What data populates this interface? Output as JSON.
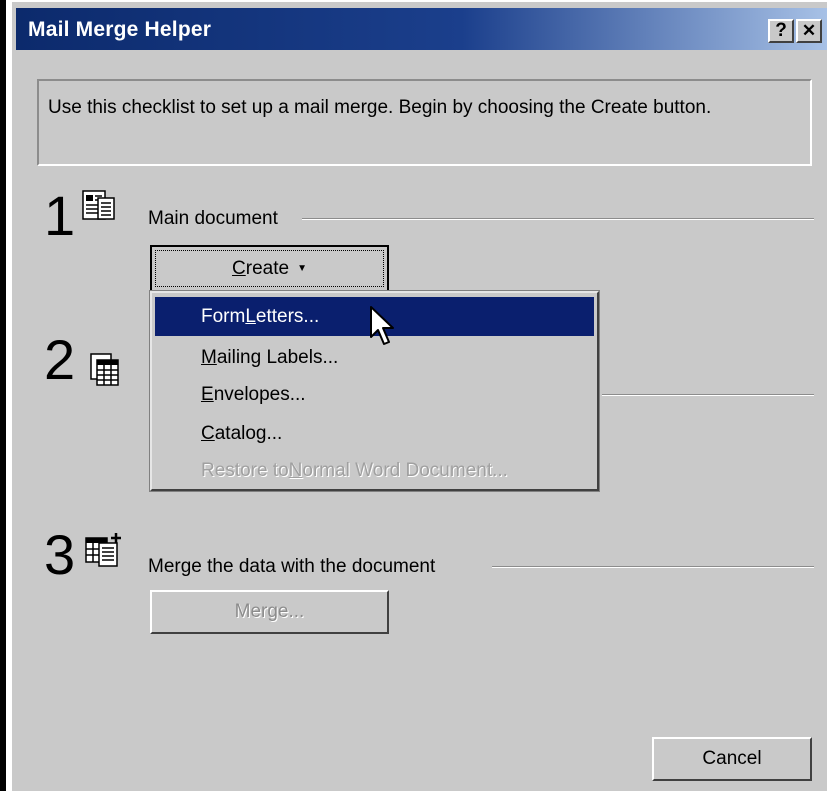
{
  "window": {
    "title": "Mail Merge Helper",
    "help_glyph": "?",
    "close_glyph": "✕"
  },
  "instructions": "Use this checklist to set up a mail merge. Begin by choosing the Create button.",
  "steps": [
    {
      "number": "1",
      "label": "Main document",
      "icon": "main-document-icon"
    },
    {
      "number": "2",
      "label": "",
      "icon": "data-source-icon"
    },
    {
      "number": "3",
      "label": "Merge the data with the document",
      "icon": "merge-icon"
    }
  ],
  "create_button": {
    "label_prefix": "",
    "label_underline": "C",
    "label_rest": "reate"
  },
  "create_menu": [
    {
      "pre": "Form ",
      "u": "L",
      "post": "etters...",
      "state": "selected"
    },
    {
      "pre": "",
      "u": "M",
      "post": "ailing Labels...",
      "state": "enabled"
    },
    {
      "pre": "",
      "u": "E",
      "post": "nvelopes...",
      "state": "enabled"
    },
    {
      "pre": "",
      "u": "C",
      "post": "atalog...",
      "state": "enabled"
    },
    {
      "pre": "Restore to ",
      "u": "N",
      "post": "ormal Word Document...",
      "state": "disabled"
    }
  ],
  "merge_button": {
    "label": "Merge..."
  },
  "cancel_button": {
    "label": "Cancel"
  },
  "colors": {
    "title_start": "#0c2a6c",
    "title_end": "#a7c1e6",
    "face": "#c9c9c9",
    "highlight": "#0a1f6e",
    "disabled_text": "#8c8c8c"
  }
}
